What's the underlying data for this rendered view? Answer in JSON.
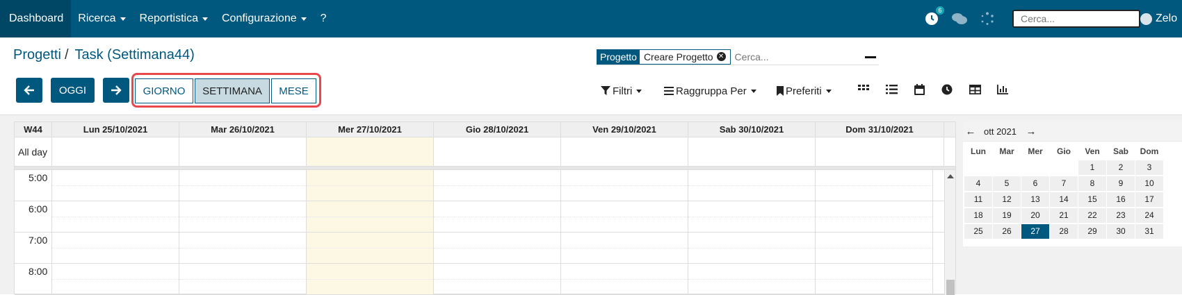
{
  "navbar": {
    "menu": [
      {
        "label": "Dashboard",
        "active": true
      },
      {
        "label": "Ricerca",
        "dropdown": true
      },
      {
        "label": "Reportistica",
        "dropdown": true
      },
      {
        "label": "Configurazione",
        "dropdown": true
      },
      {
        "label": "?",
        "dropdown": false
      }
    ],
    "activity_badge": "6",
    "search_placeholder": "Cerca...",
    "user_name": "Zelo"
  },
  "breadcrumb": {
    "parent": "Progetti",
    "separator": "/",
    "current": "Task (Settimana44)"
  },
  "search": {
    "facet_key": "Progetto",
    "facet_value": "Creare Progetto",
    "placeholder": "Cerca..."
  },
  "buttons": {
    "prev_icon": "arrow-left-icon",
    "today": "OGGI",
    "next_icon": "arrow-right-icon",
    "scales": [
      {
        "label": "GIORNO",
        "active": false
      },
      {
        "label": "SETTIMANA",
        "active": true
      },
      {
        "label": "MESE",
        "active": false
      }
    ]
  },
  "controls": {
    "filters": "Filtri",
    "group_by": "Raggruppa Per",
    "favorites": "Preferiti",
    "views": [
      "kanban-icon",
      "list-icon",
      "calendar-icon",
      "activity-icon",
      "pivot-icon",
      "graph-icon"
    ]
  },
  "calendar": {
    "week_label": "W44",
    "days": [
      "Lun 25/10/2021",
      "Mar 26/10/2021",
      "Mer 27/10/2021",
      "Gio 28/10/2021",
      "Ven 29/10/2021",
      "Sab 30/10/2021",
      "Dom 31/10/2021"
    ],
    "today_index": 2,
    "allday_label": "All day",
    "hours": [
      "5:00",
      "6:00",
      "7:00",
      "8:00"
    ]
  },
  "mini_calendar": {
    "title": "ott 2021",
    "dows": [
      "Lun",
      "Mar",
      "Mer",
      "Gio",
      "Ven",
      "Sab",
      "Dom"
    ],
    "weeks": [
      [
        "",
        "",
        "",
        "",
        "1",
        "2",
        "3"
      ],
      [
        "4",
        "5",
        "6",
        "7",
        "8",
        "9",
        "10"
      ],
      [
        "11",
        "12",
        "13",
        "14",
        "15",
        "16",
        "17"
      ],
      [
        "18",
        "19",
        "20",
        "21",
        "22",
        "23",
        "24"
      ],
      [
        "25",
        "26",
        "27",
        "28",
        "29",
        "30",
        "31"
      ]
    ],
    "selected": "27"
  },
  "colors": {
    "brand": "#00587f",
    "highlight": "#e8474c",
    "today_bg": "#fcf8e3"
  }
}
